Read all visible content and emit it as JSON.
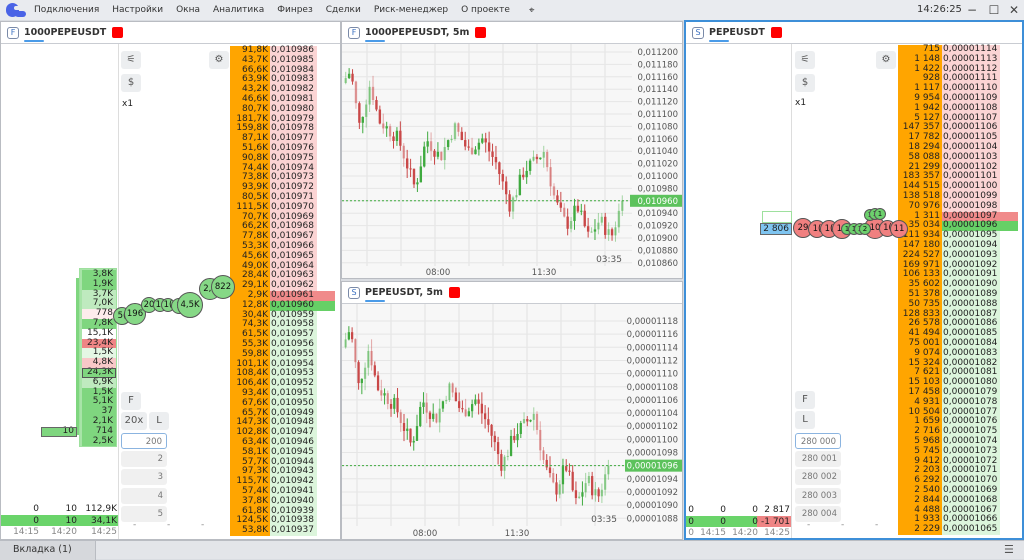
{
  "menu": {
    "items": [
      "Подключения",
      "Настройки",
      "Окна",
      "Аналитика",
      "Финрез",
      "Сделки",
      "Риск-менеджер",
      "О проекте"
    ],
    "clock": "14:26:25"
  },
  "left": {
    "badge": "F",
    "title": "1000PEPEUSDT",
    "usd_label": "$",
    "multiplier": "x1",
    "f_label": "F",
    "zoom_label": "20x",
    "l_label": "L",
    "inputs": [
      "200",
      "2",
      "3",
      "4",
      "5"
    ],
    "dashes": [
      "-",
      "-",
      "-"
    ],
    "asks": [
      [
        "91,8K",
        "0,010986"
      ],
      [
        "43,7K",
        "0,010985"
      ],
      [
        "66,6K",
        "0,010984"
      ],
      [
        "63,9K",
        "0,010983"
      ],
      [
        "43,2K",
        "0,010982"
      ],
      [
        "46,6K",
        "0,010981"
      ],
      [
        "80,7K",
        "0,010980"
      ],
      [
        "181,7K",
        "0,010979"
      ],
      [
        "159,8K",
        "0,010978"
      ],
      [
        "87,1K",
        "0,010977"
      ],
      [
        "51,6K",
        "0,010976"
      ],
      [
        "90,8K",
        "0,010975"
      ],
      [
        "74,4K",
        "0,010974"
      ],
      [
        "73,8K",
        "0,010973"
      ],
      [
        "93,9K",
        "0,010972"
      ],
      [
        "80,5K",
        "0,010971"
      ],
      [
        "111,5K",
        "0,010970"
      ],
      [
        "70,7K",
        "0,010969"
      ],
      [
        "66,2K",
        "0,010968"
      ],
      [
        "77,8K",
        "0,010967"
      ],
      [
        "53,3K",
        "0,010966"
      ],
      [
        "45,6K",
        "0,010965"
      ],
      [
        "49,0K",
        "0,010964"
      ],
      [
        "28,4K",
        "0,010963"
      ],
      [
        "29,1K",
        "0,010962"
      ],
      [
        "2,9K",
        "0,010961"
      ]
    ],
    "bids": [
      [
        "12,8K",
        "0,010960"
      ],
      [
        "30,4K",
        "0,010959"
      ],
      [
        "74,3K",
        "0,010958"
      ],
      [
        "61,5K",
        "0,010957"
      ],
      [
        "55,3K",
        "0,010956"
      ],
      [
        "59,8K",
        "0,010955"
      ],
      [
        "101,1K",
        "0,010954"
      ],
      [
        "108,4K",
        "0,010953"
      ],
      [
        "106,4K",
        "0,010952"
      ],
      [
        "93,4K",
        "0,010951"
      ],
      [
        "67,6K",
        "0,010950"
      ],
      [
        "65,7K",
        "0,010949"
      ],
      [
        "147,3K",
        "0,010948"
      ],
      [
        "102,8K",
        "0,010947"
      ],
      [
        "63,4K",
        "0,010946"
      ],
      [
        "58,1K",
        "0,010945"
      ],
      [
        "57,7K",
        "0,010944"
      ],
      [
        "97,3K",
        "0,010943"
      ],
      [
        "115,7K",
        "0,010942"
      ],
      [
        "57,4K",
        "0,010941"
      ],
      [
        "37,8K",
        "0,010940"
      ],
      [
        "61,8K",
        "0,010939"
      ],
      [
        "124,5K",
        "0,010938"
      ],
      [
        "53,8K",
        "0,010937"
      ]
    ],
    "cluster": [
      [
        "3,8K",
        "g"
      ],
      [
        "1,9K",
        "g"
      ],
      [
        "3,7K",
        "lg"
      ],
      [
        "7,0K",
        "lg"
      ],
      [
        "778",
        "pw"
      ],
      [
        "7,8K",
        "g"
      ],
      [
        "15,1K",
        "w"
      ],
      [
        "23,4K",
        "r"
      ],
      [
        "1,5K",
        "vlg"
      ],
      [
        "4,8K",
        "p"
      ],
      [
        "24,3K",
        "gb"
      ],
      [
        "6,9K",
        "lg"
      ],
      [
        "1,5K",
        "g"
      ],
      [
        "5,1K",
        "g"
      ],
      [
        "37",
        "g"
      ],
      [
        "2,1K",
        "g"
      ],
      [
        "714",
        "g"
      ],
      [
        "2,5K",
        "g"
      ]
    ],
    "cluster_single": "10",
    "bubbles": [
      "5(",
      "196",
      "20",
      "1(",
      "1(",
      "1",
      "4,5K",
      "2,7",
      "822"
    ],
    "stats_row1": [
      "0",
      "10",
      "112,9K"
    ],
    "stats_row2": [
      "0",
      "10",
      "34,1K"
    ],
    "times": [
      "14:15",
      "14:20",
      "14:25"
    ]
  },
  "chart_top": {
    "badge": "F",
    "title": "1000PEPEUSDT, 5m",
    "y_ticks": [
      "0,011200",
      "0,011180",
      "0,011160",
      "0,011140",
      "0,011120",
      "0,011100",
      "0,011080",
      "0,011060",
      "0,011040",
      "0,011020",
      "0,011000",
      "0,010980",
      "0,010960",
      "0,010940",
      "0,010920",
      "0,010900",
      "0,010880",
      "0,010860"
    ],
    "price_tag": "0,010960",
    "x_ticks": [
      "08:00",
      "11:30"
    ],
    "countdown": "03:35"
  },
  "chart_bottom": {
    "badge": "S",
    "title": "PEPEUSDT, 5m",
    "y_ticks": [
      "0,00001118",
      "0,00001116",
      "0,00001114",
      "0,00001112",
      "0,00001110",
      "0,00001108",
      "0,00001106",
      "0,00001104",
      "0,00001102",
      "0,00001100",
      "0,00001098",
      "0,00001096",
      "0,00001094",
      "0,00001092",
      "0,00001090",
      "0,00001088"
    ],
    "price_tag": "0,00001096",
    "x_ticks": [
      "08:00",
      "11:30"
    ],
    "countdown": "03:35"
  },
  "chart_data": [
    {
      "type": "candlestick",
      "title": "1000PEPEUSDT, 5m",
      "ylim": [
        0.01086,
        0.0112
      ],
      "last": 0.01096,
      "close_path": [
        [
          0,
          0.01115
        ],
        [
          0.03,
          0.01117
        ],
        [
          0.06,
          0.01108
        ],
        [
          0.1,
          0.01115
        ],
        [
          0.13,
          0.01109
        ],
        [
          0.2,
          0.01106
        ],
        [
          0.26,
          0.01098
        ],
        [
          0.3,
          0.01106
        ],
        [
          0.35,
          0.01103
        ],
        [
          0.4,
          0.01108
        ],
        [
          0.45,
          0.01104
        ],
        [
          0.5,
          0.01106
        ],
        [
          0.55,
          0.01102
        ],
        [
          0.6,
          0.01095
        ],
        [
          0.65,
          0.01101
        ],
        [
          0.68,
          0.01102
        ],
        [
          0.72,
          0.01104
        ],
        [
          0.76,
          0.01096
        ],
        [
          0.8,
          0.01092
        ],
        [
          0.84,
          0.01095
        ],
        [
          0.88,
          0.0109
        ],
        [
          0.92,
          0.01093
        ],
        [
          0.96,
          0.0109
        ],
        [
          1,
          0.01096
        ]
      ]
    },
    {
      "type": "candlestick",
      "title": "PEPEUSDT, 5m",
      "ylim": [
        1.087e-05,
        1.119e-05
      ],
      "last": 1.096e-05,
      "close_path": [
        [
          0,
          1.114e-05
        ],
        [
          0.03,
          1.117e-05
        ],
        [
          0.06,
          1.108e-05
        ],
        [
          0.1,
          1.114e-05
        ],
        [
          0.13,
          1.108e-05
        ],
        [
          0.2,
          1.105e-05
        ],
        [
          0.26,
          1.099e-05
        ],
        [
          0.3,
          1.106e-05
        ],
        [
          0.35,
          1.103e-05
        ],
        [
          0.4,
          1.108e-05
        ],
        [
          0.45,
          1.104e-05
        ],
        [
          0.5,
          1.106e-05
        ],
        [
          0.55,
          1.102e-05
        ],
        [
          0.6,
          1.096e-05
        ],
        [
          0.65,
          1.101e-05
        ],
        [
          0.68,
          1.102e-05
        ],
        [
          0.72,
          1.104e-05
        ],
        [
          0.76,
          1.096e-05
        ],
        [
          0.8,
          1.092e-05
        ],
        [
          0.84,
          1.096e-05
        ],
        [
          0.88,
          1.09e-05
        ],
        [
          0.92,
          1.094e-05
        ],
        [
          0.96,
          1.091e-05
        ],
        [
          1,
          1.096e-05
        ]
      ]
    }
  ],
  "right": {
    "badge": "S",
    "title": "PEPEUSDT",
    "usd_label": "$",
    "multiplier": "x1",
    "f_label": "F",
    "l_label": "L",
    "inputs": [
      "280 000",
      "280 001",
      "280 002",
      "280 003",
      "280 004"
    ],
    "dashes": [
      "-",
      "-",
      "-"
    ],
    "asks": [
      [
        "715",
        "0,00001114"
      ],
      [
        "1 148",
        "0,00001113"
      ],
      [
        "1 422",
        "0,00001112"
      ],
      [
        "928",
        "0,00001111"
      ],
      [
        "1 117",
        "0,00001110"
      ],
      [
        "9 954",
        "0,00001109"
      ],
      [
        "1 942",
        "0,00001108"
      ],
      [
        "5 127",
        "0,00001107"
      ],
      [
        "147 357",
        "0,00001106"
      ],
      [
        "17 782",
        "0,00001105"
      ],
      [
        "18 294",
        "0,00001104"
      ],
      [
        "58 088",
        "0,00001103"
      ],
      [
        "21 299",
        "0,00001102"
      ],
      [
        "183 357",
        "0,00001101"
      ],
      [
        "144 515",
        "0,00001100"
      ],
      [
        "138 518",
        "0,00001099"
      ],
      [
        "70 976",
        "0,00001098"
      ],
      [
        "1 311",
        "0,00001097"
      ]
    ],
    "bids": [
      [
        "35 034",
        "0,00001096"
      ],
      [
        "111 934",
        "0,00001095"
      ],
      [
        "147 180",
        "0,00001094"
      ],
      [
        "224 527",
        "0,00001093"
      ],
      [
        "169 971",
        "0,00001092"
      ],
      [
        "106 133",
        "0,00001091"
      ],
      [
        "35 602",
        "0,00001090"
      ],
      [
        "51 378",
        "0,00001089"
      ],
      [
        "50 735",
        "0,00001088"
      ],
      [
        "128 833",
        "0,00001087"
      ],
      [
        "26 578",
        "0,00001086"
      ],
      [
        "41 494",
        "0,00001085"
      ],
      [
        "75 001",
        "0,00001084"
      ],
      [
        "9 074",
        "0,00001083"
      ],
      [
        "15 324",
        "0,00001082"
      ],
      [
        "7 621",
        "0,00001081"
      ],
      [
        "15 103",
        "0,00001080"
      ],
      [
        "17 458",
        "0,00001079"
      ],
      [
        "4 931",
        "0,00001078"
      ],
      [
        "10 504",
        "0,00001077"
      ],
      [
        "1 659",
        "0,00001076"
      ],
      [
        "2 716",
        "0,00001075"
      ],
      [
        "5 968",
        "0,00001074"
      ],
      [
        "5 745",
        "0,00001073"
      ],
      [
        "9 412",
        "0,00001072"
      ],
      [
        "2 203",
        "0,00001071"
      ],
      [
        "6 292",
        "0,00001070"
      ],
      [
        "2 540",
        "0,00001069"
      ],
      [
        "2 844",
        "0,00001068"
      ],
      [
        "4 488",
        "0,00001067"
      ],
      [
        "1 933",
        "0,00001066"
      ],
      [
        "2 229",
        "0,00001065"
      ]
    ],
    "cluster_value": "2 806",
    "bubbles_red": [
      "29",
      "1(",
      "1(",
      "11",
      "10",
      "1(",
      "11"
    ],
    "bubbles_green": [
      "1",
      "1",
      "1",
      "2",
      "1",
      "1",
      "1"
    ],
    "stats_row1": [
      "0",
      "0",
      "0",
      "2 817"
    ],
    "stats_row2": [
      "0",
      "0",
      "0",
      "-1 701"
    ],
    "times": [
      "0",
      "14:15",
      "14:20",
      "14:25"
    ]
  },
  "tabs": [
    {
      "label": "Вкладка (1)"
    }
  ]
}
